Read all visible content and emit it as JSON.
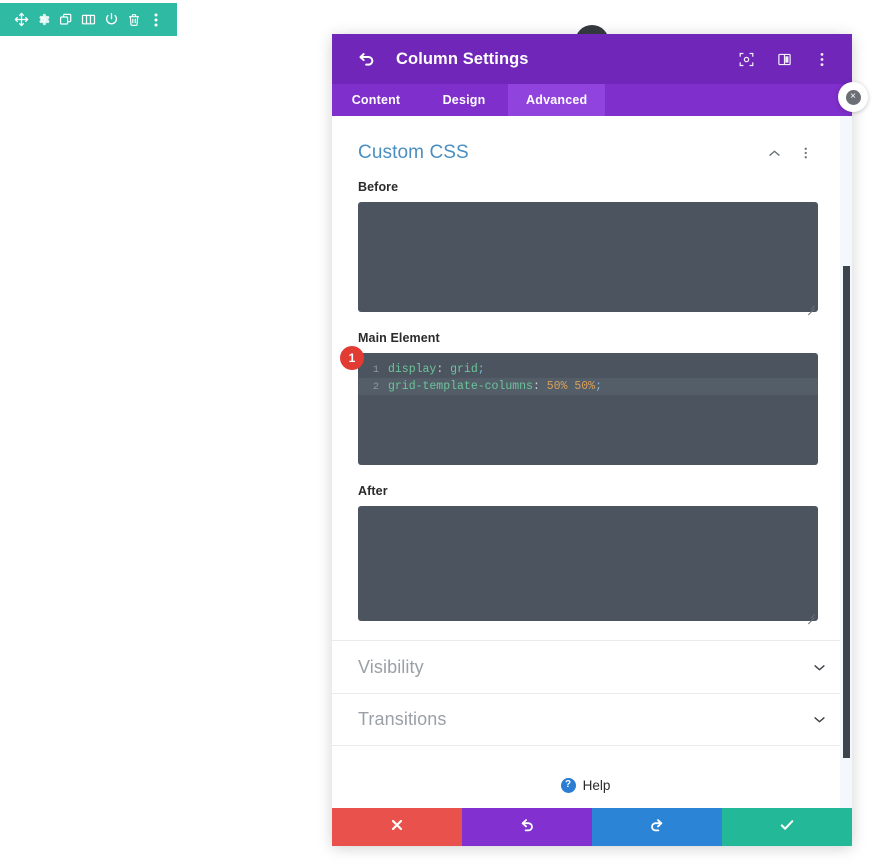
{
  "element_toolbar": {
    "icons": [
      {
        "name": "move-icon",
        "label": "Move"
      },
      {
        "name": "gear-icon",
        "label": "Settings"
      },
      {
        "name": "duplicate-icon",
        "label": "Duplicate"
      },
      {
        "name": "columns-icon",
        "label": "Columns"
      },
      {
        "name": "power-icon",
        "label": "Disable"
      },
      {
        "name": "trash-icon",
        "label": "Delete"
      },
      {
        "name": "more-vertical-icon",
        "label": "More options"
      }
    ],
    "background": "#2ebaa3"
  },
  "modal": {
    "title": "Column Settings",
    "back_icon": "back-arrow-icon",
    "header_background": "#7026b9",
    "header_icons": [
      {
        "name": "expand-icon",
        "label": "Expand"
      },
      {
        "name": "split-view-icon",
        "label": "Split view"
      },
      {
        "name": "more-vertical-icon",
        "label": "More options"
      }
    ],
    "close_label": "×",
    "tabs": [
      {
        "label": "Content",
        "active": false
      },
      {
        "label": "Design",
        "active": false
      },
      {
        "label": "Advanced",
        "active": true
      }
    ]
  },
  "custom_css": {
    "section_title": "Custom CSS",
    "collapse_icon": "chevron-up-icon",
    "menu_icon": "more-vertical-icon",
    "title_color": "#4a8fc0",
    "fields": [
      {
        "label": "Before",
        "value": ""
      },
      {
        "label": "Main Element",
        "value": "display: grid;\ngrid-template-columns: 50% 50%;"
      },
      {
        "label": "After",
        "value": ""
      }
    ],
    "code": {
      "lines": [
        {
          "number": "1",
          "active": false,
          "tokens": [
            {
              "text": "display",
              "type": "prop"
            },
            {
              "text": ": ",
              "type": "punc"
            },
            {
              "text": "grid",
              "type": "val"
            },
            {
              "text": ";",
              "type": "semi"
            }
          ]
        },
        {
          "number": "2",
          "active": true,
          "tokens": [
            {
              "text": "grid-template-columns",
              "type": "prop"
            },
            {
              "text": ": ",
              "type": "punc"
            },
            {
              "text": "50% 50%",
              "type": "num"
            },
            {
              "text": ";",
              "type": "semi"
            }
          ]
        }
      ]
    },
    "step_badge": "1",
    "step_badge_color": "#e23b34"
  },
  "sections": [
    {
      "title": "Visibility",
      "expanded": false,
      "icon": "chevron-down-icon"
    },
    {
      "title": "Transitions",
      "expanded": false,
      "icon": "chevron-down-icon"
    }
  ],
  "help": {
    "label": "Help",
    "icon_glyph": "?",
    "icon_color": "#2b7cd3"
  },
  "footer": {
    "buttons": [
      {
        "name": "cancel-button",
        "icon": "close-icon",
        "glyph": "✖",
        "color": "#e9514c"
      },
      {
        "name": "undo-button",
        "icon": "undo-icon",
        "glyph": "↺",
        "color": "#8230d0"
      },
      {
        "name": "redo-button",
        "icon": "redo-icon",
        "glyph": "↻",
        "color": "#2b84d6"
      },
      {
        "name": "save-button",
        "icon": "check-icon",
        "glyph": "✔",
        "color": "#23b897"
      }
    ]
  }
}
